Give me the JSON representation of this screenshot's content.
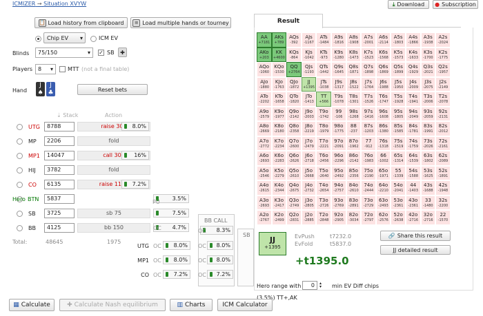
{
  "breadcrumb": {
    "home": "ICMIZER",
    "arrow": "→",
    "current": "Situation XVYW"
  },
  "top_buttons": {
    "download": "Download",
    "subscription": "Subscription"
  },
  "toolbar": {
    "load_history": "Load history from clipboard",
    "load_multiple": "Load multiple hands or tourney"
  },
  "model": {
    "chip_ev": "Chip EV",
    "icm_ev": "ICM EV",
    "selected": "Chip EV"
  },
  "blinds": {
    "label": "Blinds",
    "value": "75/150",
    "sb_label": "SB",
    "sb_checked": "✓"
  },
  "players": {
    "label": "Players",
    "value": "8",
    "mtt_label": "MTT",
    "mtt_note": "(not a final table)"
  },
  "hand": {
    "label": "Hand",
    "card1": "J",
    "card2": "J",
    "reset": "Reset bets"
  },
  "table_headers": {
    "stack": "Stack",
    "action": "Action",
    "bb_call": "BB CALL",
    "bb_call2": "SB"
  },
  "seats": [
    {
      "pos": "UTG",
      "stack": "8788",
      "action": "raise 300",
      "pct": "8.0%",
      "color": "red"
    },
    {
      "pos": "MP",
      "stack": "2206",
      "action": "fold",
      "pct": "",
      "color": "normal"
    },
    {
      "pos": "MP1",
      "stack": "14047",
      "action": "call 300",
      "pct": "16%",
      "color": "red"
    },
    {
      "pos": "HIJ",
      "stack": "3782",
      "action": "fold",
      "pct": "",
      "color": "normal"
    },
    {
      "pos": "CO",
      "stack": "6135",
      "action": "raise 1150",
      "pct": "7.2%",
      "color": "red"
    },
    {
      "pos": "BTN",
      "stack": "5837",
      "action": "",
      "pct": "3.5%",
      "color": "green",
      "hero": "Hero"
    },
    {
      "pos": "SB",
      "stack": "3725",
      "action": "sb 75",
      "pct": "7.5%",
      "color": "normal"
    },
    {
      "pos": "BB",
      "stack": "4125",
      "action": "bb 150",
      "pct": "4.7%",
      "color": "normal"
    }
  ],
  "pu_label": "PU",
  "oc_label": "OC",
  "bb_oc_pct": "8.3%",
  "total": {
    "label": "Total:",
    "stack": "48645",
    "pot": "1975"
  },
  "call_rows": [
    {
      "pos": "UTG",
      "p1": "8.0%",
      "p2": "8.0%"
    },
    {
      "pos": "MP1",
      "p1": "8.0%",
      "p2": "8.0%"
    },
    {
      "pos": "CO",
      "p1": "7.2%",
      "p2": "7.2%"
    }
  ],
  "result": {
    "tab": "Result",
    "hand": "JJ",
    "hand_ev": "+1395",
    "evpush_label": "EvPush",
    "evpush": "t7232.0",
    "evfold_label": "EvFold",
    "evfold": "t5837.0",
    "big_ev": "+t1395.0",
    "share": "Share this result",
    "detailed": "JJ detailed result",
    "hero_range_label": "Hero range with",
    "hero_range_value": "0",
    "hero_range_suffix": "min EV Diff chips",
    "range_text": "(3.5%) TT+,AK"
  },
  "bottom": {
    "calculate": "Calculate",
    "nash": "Calculate Nash equilibrium",
    "charts": "Charts",
    "icm": "ICM Calculator"
  },
  "matrix": [
    [
      [
        "AA",
        "+7181",
        "g"
      ],
      [
        "AKs",
        "+789",
        "g"
      ],
      [
        "AQs",
        "-392",
        ""
      ],
      [
        "AJs",
        "-1167",
        ""
      ],
      [
        "ATs",
        "-1484",
        ""
      ],
      [
        "A9s",
        "-1816",
        ""
      ],
      [
        "A8s",
        "-1908",
        ""
      ],
      [
        "A7s",
        "-2001",
        ""
      ],
      [
        "A6s",
        "-2114",
        ""
      ],
      [
        "A5s",
        "-1803",
        ""
      ],
      [
        "A4s",
        "-1866",
        ""
      ],
      [
        "A3s",
        "-1938",
        ""
      ],
      [
        "A2s",
        "-2024",
        ""
      ]
    ],
    [
      [
        "AKo",
        "+203",
        "g"
      ],
      [
        "KK",
        "+4600",
        "g"
      ],
      [
        "KQs",
        "-864",
        ""
      ],
      [
        "KJs",
        "-1042",
        ""
      ],
      [
        "KTs",
        "-973",
        ""
      ],
      [
        "K9s",
        "-1280",
        ""
      ],
      [
        "K8s",
        "-1473",
        ""
      ],
      [
        "K7s",
        "-1523",
        ""
      ],
      [
        "K6s",
        "-1568",
        ""
      ],
      [
        "K5s",
        "-1573",
        ""
      ],
      [
        "K4s",
        "-1633",
        ""
      ],
      [
        "K3s",
        "-1700",
        ""
      ],
      [
        "K2s",
        "-1775",
        ""
      ]
    ],
    [
      [
        "AQo",
        "-1060",
        ""
      ],
      [
        "KQo",
        "-1530",
        ""
      ],
      [
        "QQ",
        "+2764",
        "g"
      ],
      [
        "QJs",
        "-1193",
        ""
      ],
      [
        "QTs",
        "-1442",
        ""
      ],
      [
        "Q9s",
        "-1645",
        ""
      ],
      [
        "Q8s",
        "-1871",
        ""
      ],
      [
        "Q7s",
        "-1898",
        ""
      ],
      [
        "Q6s",
        "-1869",
        ""
      ],
      [
        "Q5s",
        "-1899",
        ""
      ],
      [
        "Q4s",
        "-1929",
        ""
      ],
      [
        "Q3s",
        "-2021",
        ""
      ],
      [
        "Q2s",
        "-1957",
        ""
      ]
    ],
    [
      [
        "AJo",
        "-1880",
        ""
      ],
      [
        "KJo",
        "-1763",
        ""
      ],
      [
        "QJo",
        "-1872",
        ""
      ],
      [
        "JJ",
        "+1395",
        "g2"
      ],
      [
        "JTs",
        "-1038",
        ""
      ],
      [
        "J9s",
        "-1317",
        ""
      ],
      [
        "J8s",
        "-1522",
        ""
      ],
      [
        "J7s",
        "-1764",
        ""
      ],
      [
        "J6s",
        "-1988",
        ""
      ],
      [
        "J5s",
        "-1950",
        ""
      ],
      [
        "J4s",
        "-2009",
        ""
      ],
      [
        "J3s",
        "-2075",
        ""
      ],
      [
        "J2s",
        "-2149",
        ""
      ]
    ],
    [
      [
        "ATo",
        "-2202",
        ""
      ],
      [
        "KTo",
        "-1658",
        ""
      ],
      [
        "QTo",
        "-1820",
        ""
      ],
      [
        "JTo",
        "-1413",
        ""
      ],
      [
        "TT",
        "+566",
        "g2"
      ],
      [
        "T9s",
        "-1078",
        ""
      ],
      [
        "T8s",
        "-1301",
        ""
      ],
      [
        "T7s",
        "-1526",
        ""
      ],
      [
        "T6s",
        "-1747",
        ""
      ],
      [
        "T5s",
        "-1928",
        ""
      ],
      [
        "T4s",
        "-1941",
        ""
      ],
      [
        "T3s",
        "-2006",
        ""
      ],
      [
        "T2s",
        "-2078",
        ""
      ]
    ],
    [
      [
        "A9o",
        "-2579",
        ""
      ],
      [
        "K9o",
        "-1977",
        ""
      ],
      [
        "Q9o",
        "-2142",
        ""
      ],
      [
        "J9o",
        "-2003",
        ""
      ],
      [
        "T9o",
        "-1742",
        ""
      ],
      [
        "99",
        "-106",
        ""
      ],
      [
        "98s",
        "-1268",
        ""
      ],
      [
        "97s",
        "-1416",
        ""
      ],
      [
        "96s",
        "-1608",
        ""
      ],
      [
        "95s",
        "-1805",
        ""
      ],
      [
        "94s",
        "-2049",
        ""
      ],
      [
        "93s",
        "-2059",
        ""
      ],
      [
        "92s",
        "-2131",
        ""
      ]
    ],
    [
      [
        "A8o",
        "-2669",
        ""
      ],
      [
        "K8o",
        "-2180",
        ""
      ],
      [
        "Q8o",
        "-2358",
        ""
      ],
      [
        "J8o",
        "-2219",
        ""
      ],
      [
        "T8o",
        "-1979",
        ""
      ],
      [
        "98o",
        "-1775",
        ""
      ],
      [
        "88",
        "-237",
        ""
      ],
      [
        "87s",
        "-1203",
        ""
      ],
      [
        "86s",
        "-1380",
        ""
      ],
      [
        "85s",
        "-1585",
        ""
      ],
      [
        "84s",
        "-1781",
        ""
      ],
      [
        "83s",
        "-1991",
        ""
      ],
      [
        "82s",
        "-2012",
        ""
      ]
    ],
    [
      [
        "A7o",
        "-2772",
        ""
      ],
      [
        "K7o",
        "-2234",
        ""
      ],
      [
        "Q7o",
        "-2600",
        ""
      ],
      [
        "J7o",
        "-2479",
        ""
      ],
      [
        "T7o",
        "-2221",
        ""
      ],
      [
        "97o",
        "-2091",
        ""
      ],
      [
        "87o",
        "-1962",
        ""
      ],
      [
        "77",
        "-912",
        ""
      ],
      [
        "76s",
        "-1318",
        ""
      ],
      [
        "75s",
        "-1519",
        ""
      ],
      [
        "74s",
        "-1759",
        ""
      ],
      [
        "73s",
        "-2026",
        ""
      ],
      [
        "72s",
        "-2161",
        ""
      ]
    ],
    [
      [
        "A6o",
        "-2693",
        ""
      ],
      [
        "K6o",
        "-2283",
        ""
      ],
      [
        "Q6o",
        "-2626",
        ""
      ],
      [
        "J6o",
        "-2718",
        ""
      ],
      [
        "T6o",
        "-2456",
        ""
      ],
      [
        "96o",
        "-2296",
        ""
      ],
      [
        "86o",
        "-2142",
        ""
      ],
      [
        "76o",
        "-1983",
        ""
      ],
      [
        "66",
        "-1002",
        ""
      ],
      [
        "65s",
        "-1314",
        ""
      ],
      [
        "64s",
        "-1539",
        ""
      ],
      [
        "63s",
        "-1802",
        ""
      ],
      [
        "62s",
        "-2089",
        ""
      ]
    ],
    [
      [
        "A5o",
        "-2546",
        ""
      ],
      [
        "K5o",
        "-2279",
        ""
      ],
      [
        "Q5o",
        "-2610",
        ""
      ],
      [
        "J5o",
        "-2668",
        ""
      ],
      [
        "T5o",
        "-2640",
        ""
      ],
      [
        "95o",
        "-2492",
        ""
      ],
      [
        "85o",
        "-2356",
        ""
      ],
      [
        "75o",
        "-2190",
        ""
      ],
      [
        "65o",
        "-1971",
        ""
      ],
      [
        "55",
        "-1339",
        ""
      ],
      [
        "54s",
        "-1588",
        ""
      ],
      [
        "53s",
        "-1625",
        ""
      ],
      [
        "52s",
        "-1891",
        ""
      ]
    ],
    [
      [
        "A4o",
        "-2615",
        ""
      ],
      [
        "K4o",
        "-2344",
        ""
      ],
      [
        "Q4o",
        "-2675",
        ""
      ],
      [
        "J4o",
        "-2732",
        ""
      ],
      [
        "T4o",
        "-2654",
        ""
      ],
      [
        "94o",
        "-2757",
        ""
      ],
      [
        "84o",
        "-2610",
        ""
      ],
      [
        "74o",
        "-2444",
        ""
      ],
      [
        "64o",
        "-2210",
        ""
      ],
      [
        "54o",
        "-2041",
        ""
      ],
      [
        "44",
        "-1403",
        ""
      ],
      [
        "43s",
        "-1688",
        ""
      ],
      [
        "42s",
        "-1948",
        ""
      ]
    ],
    [
      [
        "A3o",
        "-2693",
        ""
      ],
      [
        "K3o",
        "-2417",
        ""
      ],
      [
        "Q3o",
        "-2749",
        ""
      ],
      [
        "J3o",
        "-2805",
        ""
      ],
      [
        "T3o",
        "-2726",
        ""
      ],
      [
        "93o",
        "-2769",
        ""
      ],
      [
        "83o",
        "-2891",
        ""
      ],
      [
        "73o",
        "-2729",
        ""
      ],
      [
        "63o",
        "-2493",
        ""
      ],
      [
        "53o",
        "-2361",
        ""
      ],
      [
        "43o",
        "-2361",
        ""
      ],
      [
        "33",
        "-1480",
        ""
      ],
      [
        "32s",
        "-2200",
        ""
      ]
    ],
    [
      [
        "A2o",
        "-2767",
        ""
      ],
      [
        "K2o",
        "-2499",
        ""
      ],
      [
        "Q2o",
        "-2831",
        ""
      ],
      [
        "J2o",
        "-2885",
        ""
      ],
      [
        "T2o",
        "-2848",
        ""
      ],
      [
        "92o",
        "-2905",
        ""
      ],
      [
        "82o",
        "-3034",
        ""
      ],
      [
        "72o",
        "-2797",
        ""
      ],
      [
        "62o",
        "-2576",
        ""
      ],
      [
        "52o",
        "-2638",
        ""
      ],
      [
        "42o",
        "-2716",
        ""
      ],
      [
        "32o",
        "-2716",
        ""
      ],
      [
        "22",
        "-1570",
        ""
      ]
    ]
  ]
}
